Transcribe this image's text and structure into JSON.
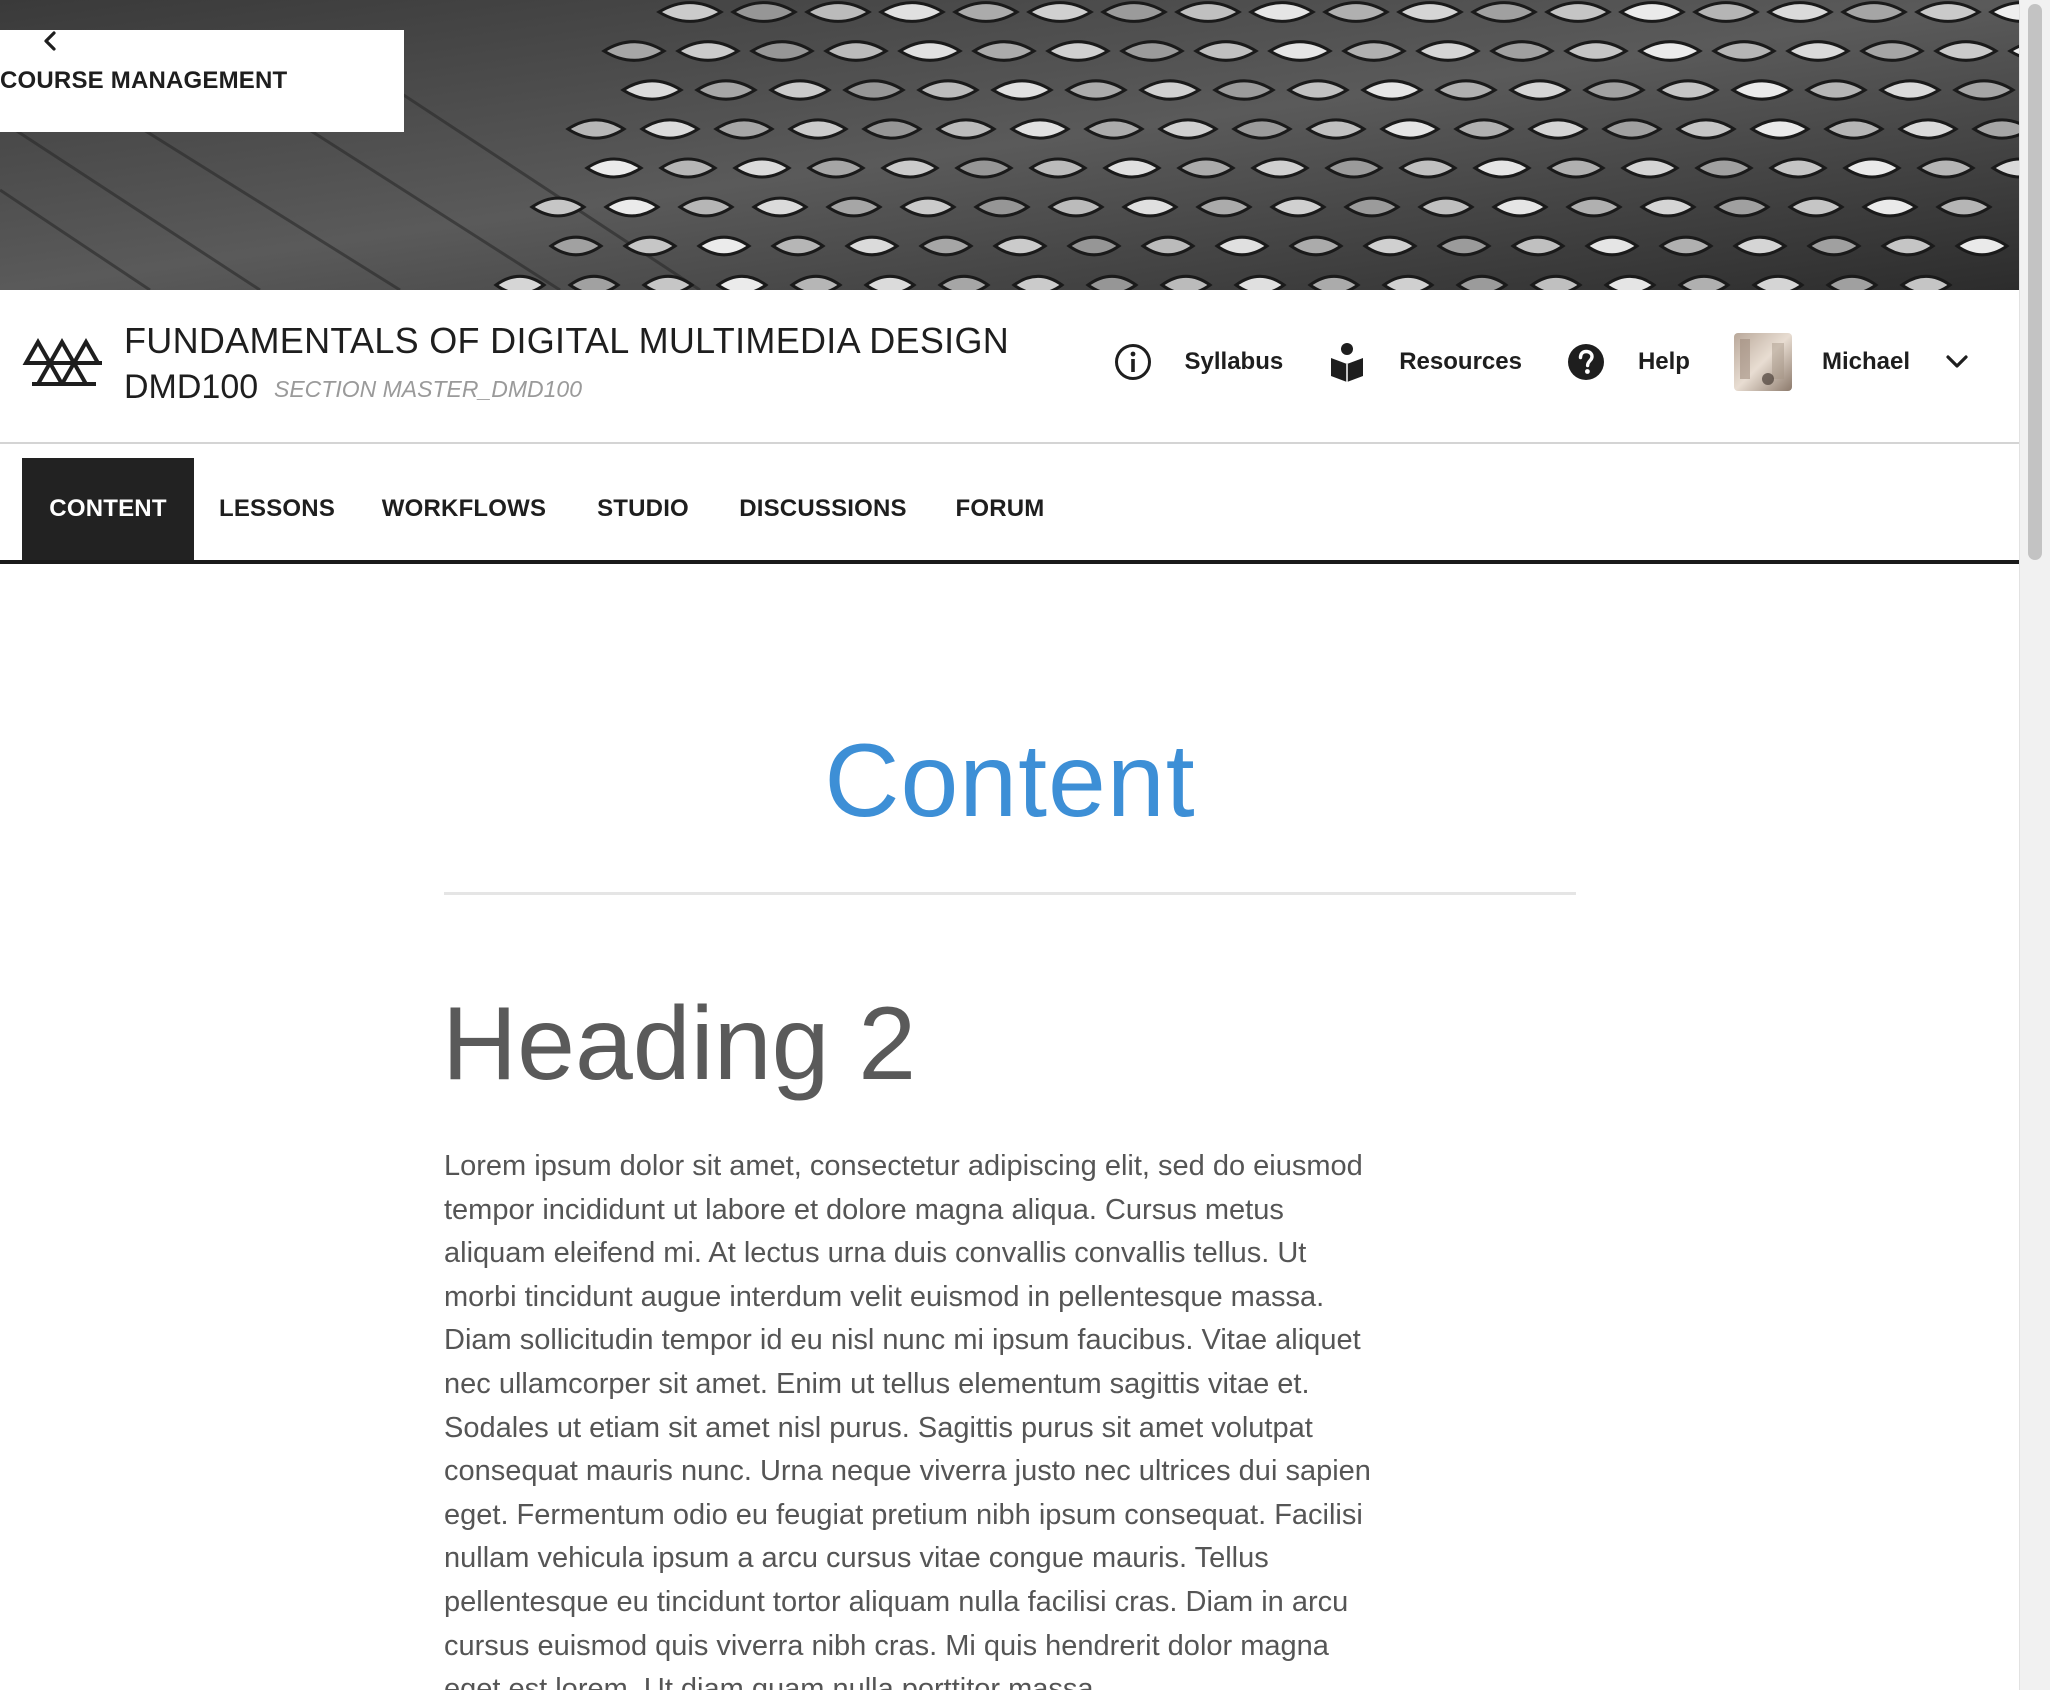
{
  "banner": {
    "back_label": "COURSE MANAGEMENT"
  },
  "course": {
    "title": "FUNDAMENTALS OF DIGITAL MULTIMEDIA DESIGN",
    "code": "DMD100",
    "section": "SECTION MASTER_DMD100"
  },
  "header_actions": {
    "syllabus": "Syllabus",
    "resources": "Resources",
    "help": "Help",
    "user_name": "Michael",
    "icons": [
      "info-circle-icon",
      "book-reader-icon",
      "question-circle-icon",
      "chevron-down-icon"
    ]
  },
  "tabs": [
    {
      "label": "CONTENT",
      "active": true
    },
    {
      "label": "LESSONS",
      "active": false
    },
    {
      "label": "WORKFLOWS",
      "active": false
    },
    {
      "label": "STUDIO",
      "active": false
    },
    {
      "label": "DISCUSSIONS",
      "active": false
    },
    {
      "label": "FORUM",
      "active": false
    }
  ],
  "main": {
    "title": "Content",
    "heading": "Heading 2",
    "paragraph": "Lorem ipsum dolor sit amet, consectetur adipiscing elit, sed do eiusmod tempor incididunt ut labore et dolore magna aliqua. Cursus metus aliquam eleifend mi. At lectus urna duis convallis convallis tellus. Ut morbi tincidunt augue interdum velit euismod in pellentesque massa. Diam sollicitudin tempor id eu nisl nunc mi ipsum faucibus. Vitae aliquet nec ullamcorper sit amet. Enim ut tellus elementum sagittis vitae et. Sodales ut etiam sit amet nisl purus. Sagittis purus sit amet volutpat consequat mauris nunc. Urna neque viverra justo nec ultrices dui sapien eget. Fermentum odio eu feugiat pretium nibh ipsum consequat. Facilisi nullam vehicula ipsum a arcu cursus vitae congue mauris. Tellus pellentesque eu tincidunt tortor aliquam nulla facilisi cras. Diam in arcu cursus euismod quis viverra nibh cras. Mi quis hendrerit dolor magna eget est lorem. Ut diam quam nulla porttitor massa."
  },
  "colors": {
    "accent": "#3d8fd6",
    "active_tab_bg": "#222222",
    "text_dark": "#1e1e1e",
    "text_body": "#555555"
  }
}
